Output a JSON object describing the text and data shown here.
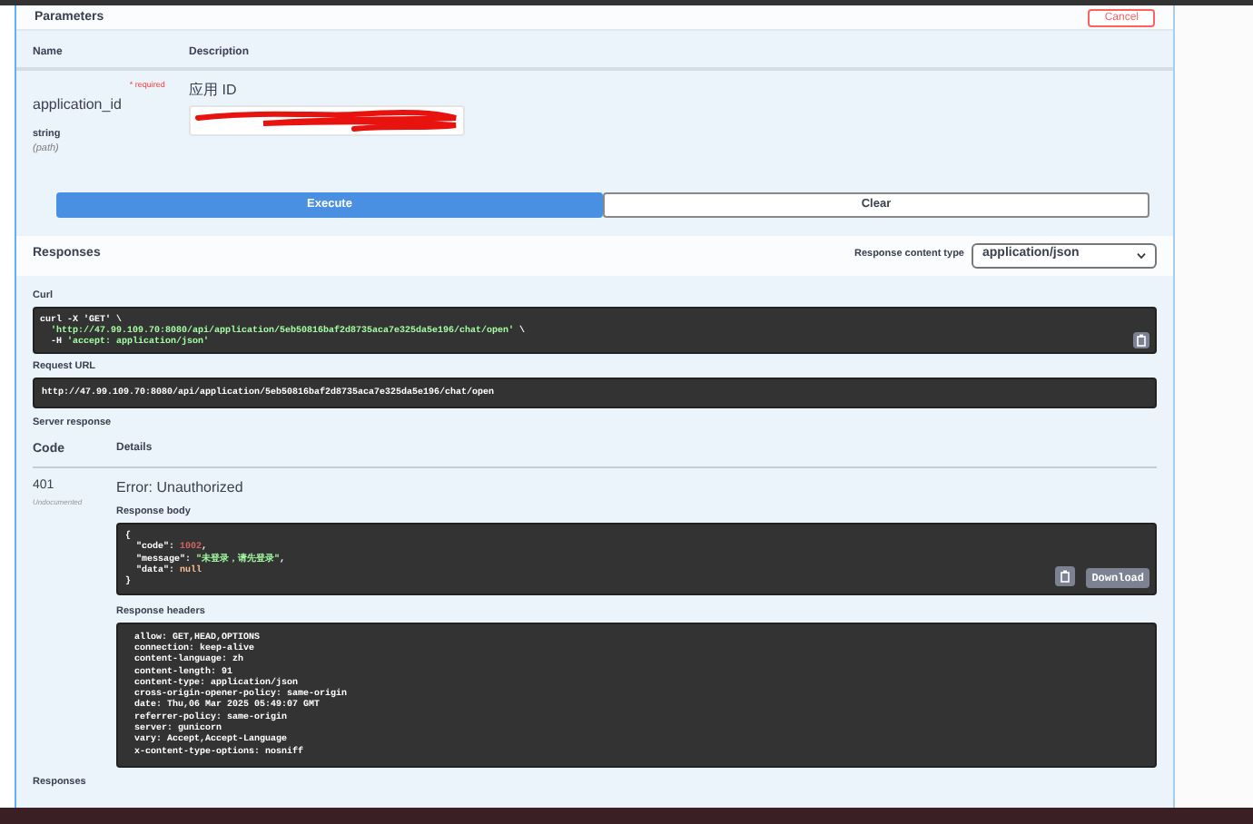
{
  "parameters_header": {
    "title": "Parameters",
    "cancel_button": "Cancel"
  },
  "param_columns": [
    "Name",
    "Description"
  ],
  "parameter": {
    "name": "application_id",
    "required_label": "* required",
    "type": "string",
    "location": "(path)",
    "description": "应用 ID",
    "value_redacted": true
  },
  "buttons": [
    {
      "label": "Execute",
      "kind": "primary"
    },
    {
      "label": "Clear",
      "kind": "secondary"
    }
  ],
  "responses": {
    "title": "Responses",
    "content_type_label": "Response content type",
    "content_type_value": "application/json"
  },
  "curl": {
    "label": "Curl",
    "lines": [
      [
        {
          "text": "curl -X 'GET' \\",
          "kind": "plain"
        }
      ],
      [
        {
          "text": "  'http://47.99.109.70:8080/api/application/5eb50816baf2d8735aca7e325da5e196/chat/open'",
          "kind": "string"
        },
        {
          "text": " \\",
          "kind": "plain"
        }
      ],
      [
        {
          "text": "  -H ",
          "kind": "plain"
        },
        {
          "text": "'accept: application/json'",
          "kind": "string"
        }
      ]
    ]
  },
  "request_url": {
    "label": "Request URL",
    "value": "http://47.99.109.70:8080/api/application/5eb50816baf2d8735aca7e325da5e196/chat/open"
  },
  "server_response": {
    "label": "Server response",
    "columns": [
      "Code",
      "Details"
    ],
    "code": "401",
    "code_note": "Undocumented",
    "error": "Error: Unauthorized",
    "body_label": "Response body",
    "body_lines": [
      [
        {
          "text": "{",
          "kind": "plain"
        }
      ],
      [
        {
          "text": "  \"code\": ",
          "kind": "plain"
        },
        {
          "text": "1002",
          "kind": "number"
        },
        {
          "text": ",",
          "kind": "plain"
        }
      ],
      [
        {
          "text": "  \"message\": ",
          "kind": "plain"
        },
        {
          "text": "\"未登录，请先登录\"",
          "kind": "string"
        },
        {
          "text": ",",
          "kind": "plain"
        }
      ],
      [
        {
          "text": "  \"data\": ",
          "kind": "plain"
        },
        {
          "text": "null",
          "kind": "null"
        }
      ],
      [
        {
          "text": "}",
          "kind": "plain"
        }
      ]
    ],
    "download_button": "Download",
    "headers_label": "Response headers",
    "headers": [
      " allow: GET,HEAD,OPTIONS ",
      " connection: keep-alive ",
      " content-language: zh ",
      " content-length: 91 ",
      " content-type: application/json ",
      " cross-origin-opener-policy: same-origin ",
      " date: Thu,06 Mar 2025 05:49:07 GMT ",
      " referrer-policy: same-origin ",
      " server: gunicorn ",
      " vary: Accept,Accept-Language ",
      " x-content-type-options: nosniff "
    ]
  },
  "footer": {
    "title": "Responses"
  }
}
